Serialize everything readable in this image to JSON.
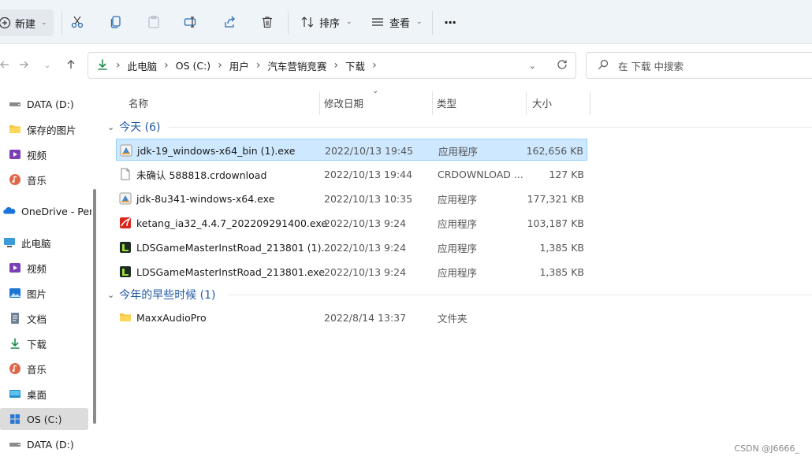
{
  "toolbar": {
    "new_label": "新建",
    "sort_label": "排序",
    "view_label": "查看",
    "more_label": "···"
  },
  "address": {
    "crumbs": [
      "此电脑",
      "OS (C:)",
      "用户",
      "汽车营销竞赛",
      "下载"
    ]
  },
  "search": {
    "placeholder": "在 下载 中搜索"
  },
  "sidebar": {
    "items": [
      {
        "label": "DATA (D:)",
        "icon": "drive-icon"
      },
      {
        "label": "保存的图片",
        "icon": "folder-icon"
      },
      {
        "label": "视频",
        "icon": "video-icon"
      },
      {
        "label": "音乐",
        "icon": "music-icon"
      },
      {
        "label": "OneDrive - Per",
        "icon": "onedrive-icon"
      },
      {
        "label": "此电脑",
        "icon": "pc-icon"
      },
      {
        "label": "视频",
        "icon": "video-icon"
      },
      {
        "label": "图片",
        "icon": "pictures-icon"
      },
      {
        "label": "文档",
        "icon": "documents-icon"
      },
      {
        "label": "下载",
        "icon": "downloads-icon"
      },
      {
        "label": "音乐",
        "icon": "music-icon"
      },
      {
        "label": "桌面",
        "icon": "desktop-icon"
      },
      {
        "label": "OS (C:)",
        "icon": "windows-drive-icon"
      },
      {
        "label": "DATA (D:)",
        "icon": "drive-icon"
      }
    ]
  },
  "columns": {
    "name": "名称",
    "date": "修改日期",
    "type": "类型",
    "size": "大小"
  },
  "groups": [
    {
      "title": "今天 (6)",
      "files": [
        {
          "name": "jdk-19_windows-x64_bin (1).exe",
          "date": "2022/10/13 19:45",
          "type": "应用程序",
          "size": "162,656 KB",
          "icon": "installer-icon"
        },
        {
          "name": "未确认 588818.crdownload",
          "date": "2022/10/13 19:44",
          "type": "CRDOWNLOAD ...",
          "size": "127 KB",
          "icon": "file-icon"
        },
        {
          "name": "jdk-8u341-windows-x64.exe",
          "date": "2022/10/13 10:35",
          "type": "应用程序",
          "size": "177,321 KB",
          "icon": "installer-icon"
        },
        {
          "name": "ketang_ia32_4.4.7_202209291400.exe",
          "date": "2022/10/13 9:24",
          "type": "应用程序",
          "size": "103,187 KB",
          "icon": "ketang-icon"
        },
        {
          "name": "LDSGameMasterInstRoad_213801 (1)....",
          "date": "2022/10/13 9:24",
          "type": "应用程序",
          "size": "1,385 KB",
          "icon": "game-icon"
        },
        {
          "name": "LDSGameMasterInstRoad_213801.exe",
          "date": "2022/10/13 9:24",
          "type": "应用程序",
          "size": "1,385 KB",
          "icon": "game-icon"
        }
      ]
    },
    {
      "title": "今年的早些时候 (1)",
      "files": [
        {
          "name": "MaxxAudioPro",
          "date": "2022/8/14 13:37",
          "type": "文件夹",
          "size": "",
          "icon": "folder-icon"
        }
      ]
    }
  ],
  "watermark": "CSDN @J6666_"
}
